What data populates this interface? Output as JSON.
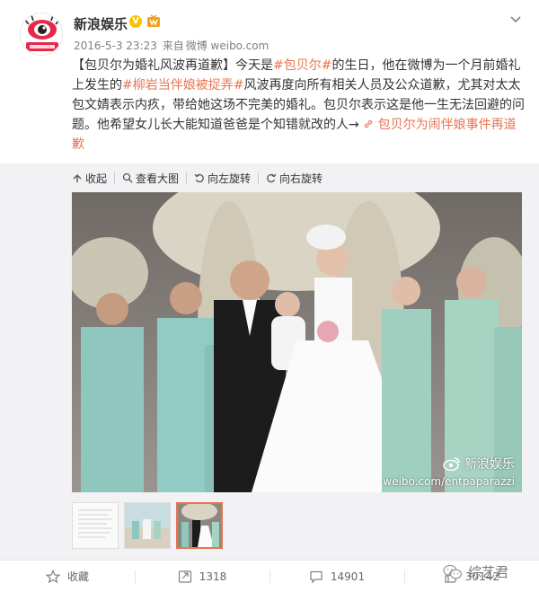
{
  "author": {
    "name": "新浪娱乐",
    "verified_badge": "V"
  },
  "meta": {
    "time": "2016-5-3 23:23",
    "from_label": "来自",
    "source": "微博 weibo.com"
  },
  "post": {
    "t1": "【包贝尔为婚礼风波再道歉】",
    "t2": "今天是",
    "hashtag1": "#包贝尔#",
    "t3": "的生日，他在微博为一个月前婚礼上发生的",
    "hashtag2": "#柳岩当伴娘被捉弄#",
    "t4": "风波再度向所有相关人员及公众道歉，尤其对太太包文婧表示内疚，带给她这场不完美的婚礼。包贝尔表示这是他一生无法回避的问题。他希望女儿长大能知道爸爸是个知错就改的人→",
    "link": "包贝尔为闹伴娘事件再道歉"
  },
  "media_tools": {
    "collapse": "收起",
    "view_large": "查看大图",
    "rotate_left": "向左旋转",
    "rotate_right": "向右旋转"
  },
  "photo": {
    "watermark_name": "新浪娱乐",
    "watermark_url": "weibo.com/entpaparazzi"
  },
  "thumbnails": {
    "selected_index": 2,
    "count": 3
  },
  "actions": {
    "favorite": "收藏",
    "repost": "1318",
    "comment": "14901",
    "like": "30142"
  },
  "overlay": {
    "wechat_label": "综艺君"
  },
  "colors": {
    "accent": "#eb7350",
    "text": "#333333",
    "meta": "#808080",
    "media_bg": "#f2f2f5"
  },
  "icons": [
    "weibo-eye-logo",
    "verified-v-icon",
    "member-icon",
    "chevron-down-icon",
    "collapse-icon",
    "search-icon",
    "rotate-left-icon",
    "rotate-right-icon",
    "weibo-icon",
    "star-icon",
    "repost-icon",
    "comment-icon",
    "like-icon",
    "wechat-icon"
  ]
}
